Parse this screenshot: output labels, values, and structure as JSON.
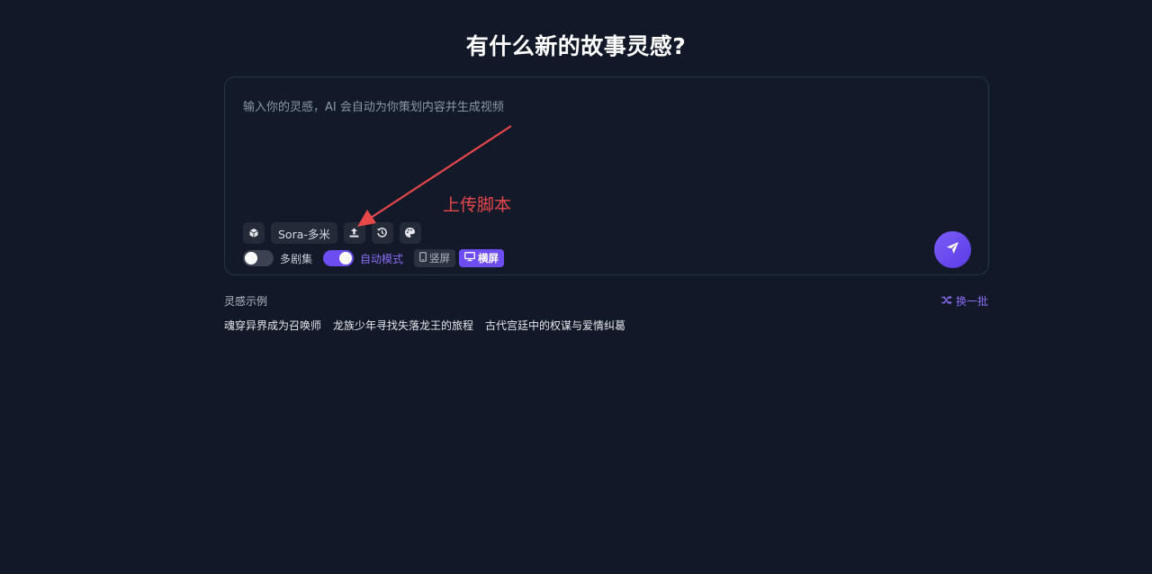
{
  "header": {
    "title": "有什么新的故事灵感?"
  },
  "composer": {
    "placeholder": "输入你的灵感，AI 会自动为你策划内容并生成视频",
    "toolbar": {
      "model_label": "Sora-多米",
      "icons": [
        "cube-icon",
        "upload-icon",
        "history-icon",
        "palette-icon"
      ]
    },
    "options": {
      "multi_episode_label": "多剧集",
      "multi_episode_on": false,
      "auto_mode_label": "自动模式",
      "auto_mode_on": true,
      "portrait_label": "竖屏",
      "landscape_label": "横屏",
      "selected_ratio": "横屏"
    },
    "send_icon": "paper-plane-icon"
  },
  "annotation": {
    "text": "上传脚本",
    "color": "#e8474a"
  },
  "examples": {
    "header": "灵感示例",
    "shuffle_label": "换一批",
    "items": [
      "魂穿异界成为召唤师",
      "龙族少年寻找失落龙王的旅程",
      "古代宫廷中的权谋与爱情纠葛"
    ]
  },
  "colors": {
    "background": "#111827",
    "accent": "#6d4df2",
    "accent_text": "#8b6cf6"
  }
}
